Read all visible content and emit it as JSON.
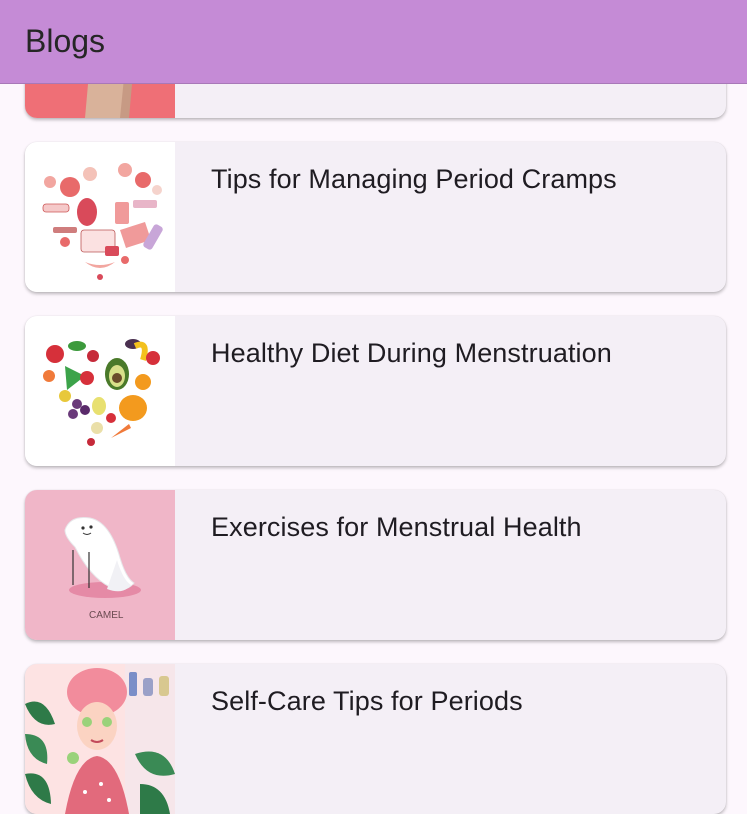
{
  "app_bar": {
    "title": "Blogs"
  },
  "blogs": [
    {
      "title": "",
      "thumbnail": "period-illustration-partial"
    },
    {
      "title": "Tips for Managing Period Cramps",
      "thumbnail": "menstrual-items-heart-collage"
    },
    {
      "title": "Healthy Diet During Menstruation",
      "thumbnail": "fruit-vegetable-heart"
    },
    {
      "title": "Exercises for Menstrual Health",
      "thumbnail": "sanitary-pad-character-camel"
    },
    {
      "title": "Self-Care Tips for Periods",
      "thumbnail": "woman-face-mask-selfcare"
    }
  ],
  "thumb_caption": "CAMEL",
  "colors": {
    "app_bar": "#c58bd6",
    "card": "#f4eff6",
    "background": "#fdf7fd"
  }
}
